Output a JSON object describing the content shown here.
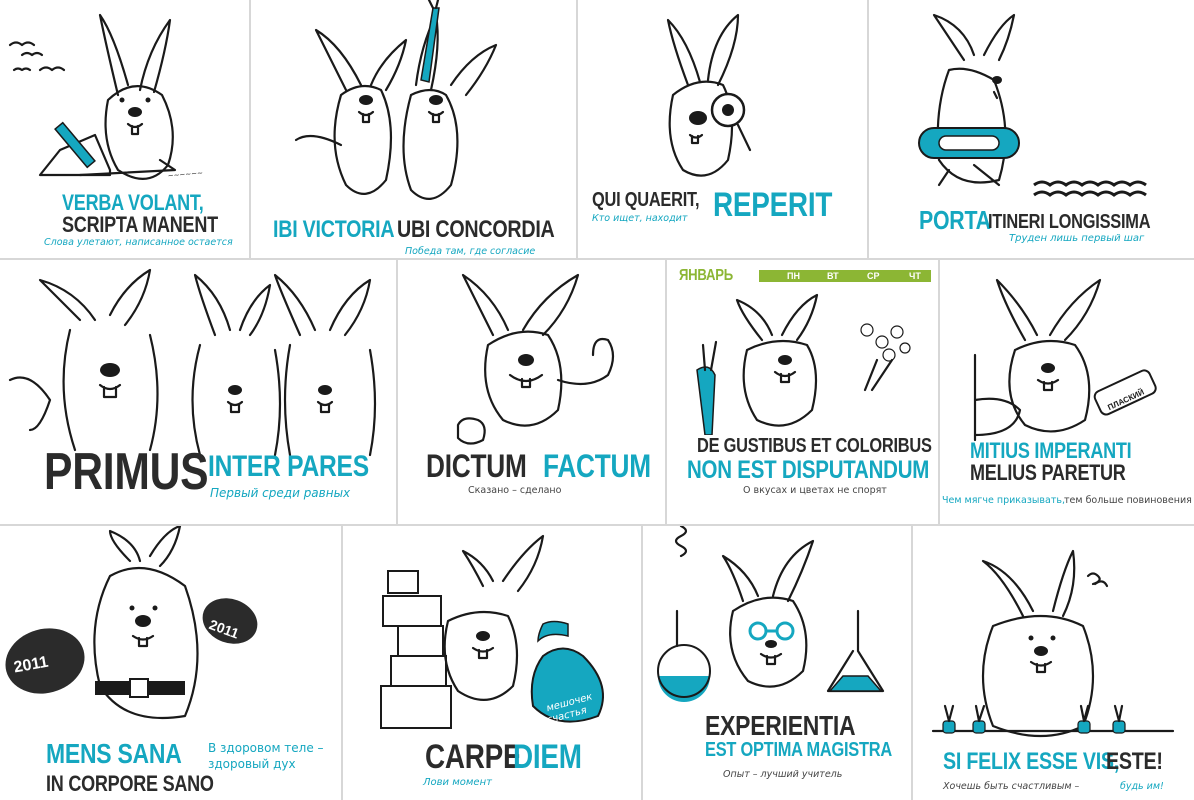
{
  "colors": {
    "accent": "#15a7c0",
    "ink": "#2b2b2b",
    "calendar_green": "#8cb634",
    "background": "#ffffff"
  },
  "cards": {
    "c1": {
      "line1": "VERBA VOLANT,",
      "line2": "SCRIPTA MANENT",
      "translation": "Слова улетают, написанное остается"
    },
    "c2": {
      "teal": "IBI VICTORIA",
      "dark": "UBI CONCORDIA",
      "translation": "Победа там, где согласие"
    },
    "c3": {
      "dark": "QUI QUAERIT,",
      "teal": "REPERIT",
      "translation": "Кто ищет, находит"
    },
    "c4": {
      "teal": "PORTA",
      "dark": "ITINERI LONGISSIMA",
      "translation": "Труден лишь первый шаг"
    },
    "c5": {
      "dark": "PRIMUS",
      "teal": "INTER PARES",
      "translation": "Первый среди равных"
    },
    "c6": {
      "dark": "DICTUM",
      "teal": "FACTUM",
      "translation": "Сказано – сделано"
    },
    "c7": {
      "month": "ЯНВАРЬ",
      "days": [
        "ПН",
        "ВТ",
        "СР",
        "ЧТ"
      ],
      "line1": "DE GUSTIBUS ET COLORIBUS",
      "line2": "NON EST DISPUTANDUM",
      "translation": "О вкусах и цветах не спорят",
      "carrot_label": ""
    },
    "c8": {
      "line1": "MITIUS IMPERANTI",
      "line2": "MELIUS PARETUR",
      "translation_teal": "Чем мягче приказывать,",
      "translation_dark": "тем больше повиновения",
      "sign_label": "ПЛАСКИЙ"
    },
    "c9": {
      "teal": "MENS SANA",
      "dark": "IN CORPORE SANO",
      "translation_line1": "В здоровом теле –",
      "translation_line2": "здоровый дух",
      "weight_label": "2011"
    },
    "c10": {
      "dark": "CARPE",
      "teal": "DIEM",
      "translation": "Лови момент",
      "bag_line1": "мешочек",
      "bag_line2": "счастья"
    },
    "c11": {
      "line1": "EXPERIENTIA",
      "line2": "EST OPTIMA MAGISTRA",
      "translation": "Опыт – лучший учитель"
    },
    "c12": {
      "teal": "SI FELIX ESSE VIS,",
      "dark": "ESTE!",
      "translation_dark": "Хочешь быть счастливым –",
      "translation_teal": "будь им!"
    }
  }
}
